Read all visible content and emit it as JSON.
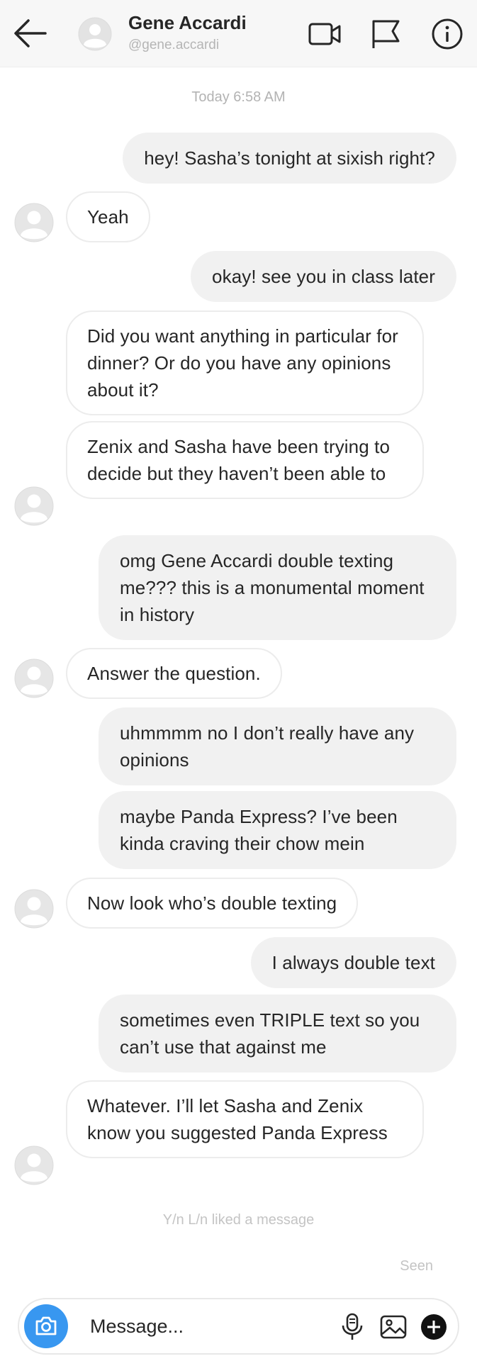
{
  "header": {
    "name": "Gene Accardi",
    "handle": "@gene.accardi"
  },
  "conversation": {
    "timestamp": "Today 6:58 AM",
    "messages": [
      {
        "from": "me",
        "text": "hey! Sasha’s tonight at sixish right?"
      },
      {
        "from": "them",
        "text": "Yeah"
      },
      {
        "from": "me",
        "text": "okay! see you in class later"
      },
      {
        "from": "them",
        "text": "Did you want anything in particular for dinner? Or do you have any opinions about it?"
      },
      {
        "from": "them",
        "text": "Zenix and Sasha have been trying to decide but they haven’t been able to"
      },
      {
        "from": "me",
        "text": "omg Gene Accardi double texting me??? this is a monumental moment in history"
      },
      {
        "from": "them",
        "text": "Answer the question."
      },
      {
        "from": "me",
        "text": "uhmmmm no I don’t really have any opinions"
      },
      {
        "from": "me",
        "text": "maybe Panda Express? I’ve been kinda craving their chow mein"
      },
      {
        "from": "them",
        "text": "Now look who’s double texting"
      },
      {
        "from": "me",
        "text": "I always double text"
      },
      {
        "from": "me",
        "text": "sometimes even TRIPLE text so you can’t use that against me"
      },
      {
        "from": "them",
        "text": "Whatever. I’ll let Sasha and Zenix know you suggested Panda Express"
      }
    ],
    "liked_notice": "Y/n L/n liked a message",
    "seen_label": "Seen"
  },
  "composer": {
    "placeholder": "Message..."
  },
  "icons": {
    "back": "arrow-left-icon",
    "video": "video-camera-icon",
    "flag": "flag-icon",
    "info": "info-icon",
    "camera": "camera-icon",
    "mic": "microphone-icon",
    "gallery": "image-icon",
    "plus": "plus-circle-icon"
  },
  "colors": {
    "accent": "#3897f0",
    "outgoing_bubble": "#f1f1f1",
    "incoming_border": "#ececec",
    "header_bg": "#f7f7f7"
  }
}
